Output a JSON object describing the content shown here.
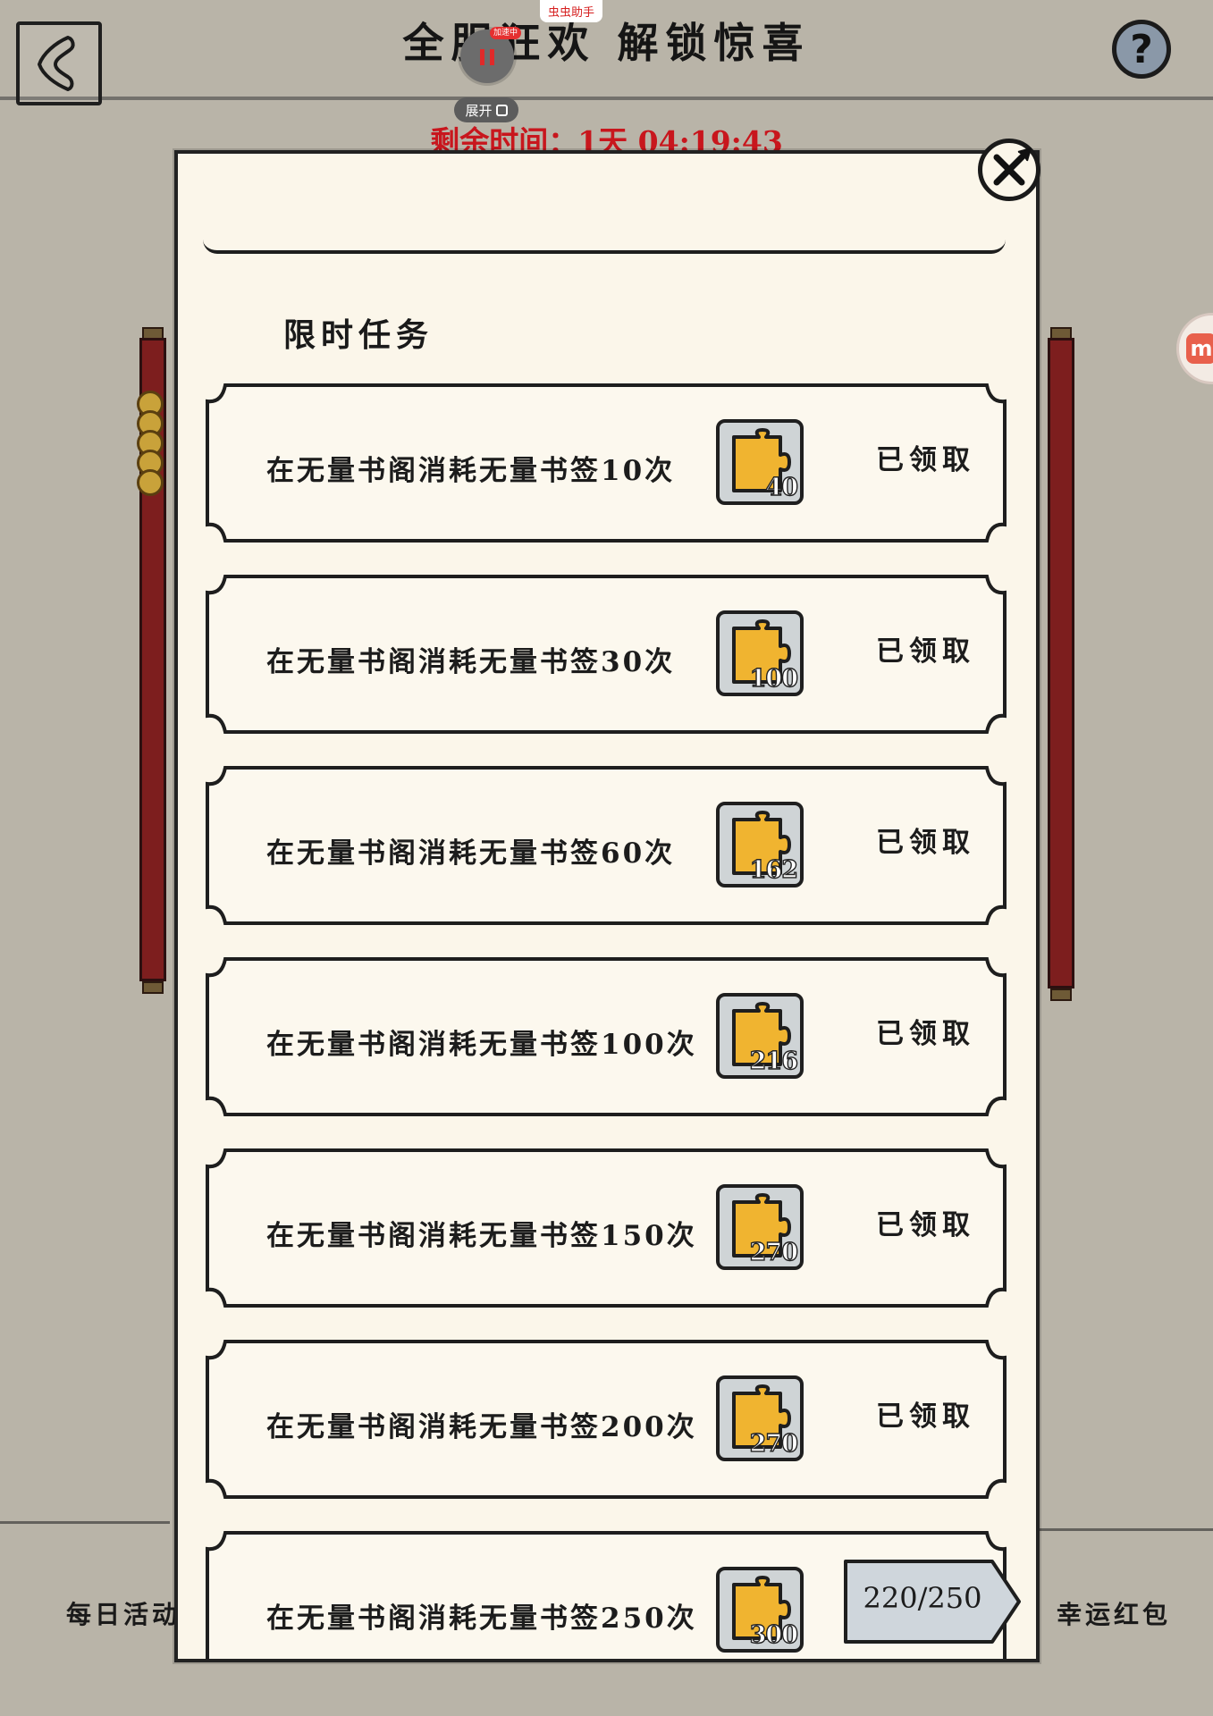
{
  "header": {
    "title": "全服狂欢 解锁惊喜",
    "countdown": "剩余时间：1天 04:19:43"
  },
  "overlay_helper": {
    "tag": "虫虫助手",
    "speed_badge": "加速中",
    "expand_label": "展开"
  },
  "help": {
    "symbol": "?"
  },
  "side_badge": {
    "letter": "m"
  },
  "modal": {
    "section_title": "限时任务",
    "tasks": [
      {
        "description": "在无量书阁消耗无量书签10次",
        "reward_icon": "bookmark-piece-icon",
        "reward_count": "40",
        "status": "已领取"
      },
      {
        "description": "在无量书阁消耗无量书签30次",
        "reward_icon": "bookmark-piece-icon",
        "reward_count": "100",
        "status": "已领取"
      },
      {
        "description": "在无量书阁消耗无量书签60次",
        "reward_icon": "bookmark-piece-icon",
        "reward_count": "162",
        "status": "已领取"
      },
      {
        "description": "在无量书阁消耗无量书签100次",
        "reward_icon": "bookmark-piece-icon",
        "reward_count": "216",
        "status": "已领取"
      },
      {
        "description": "在无量书阁消耗无量书签150次",
        "reward_icon": "bookmark-piece-icon",
        "reward_count": "270",
        "status": "已领取"
      },
      {
        "description": "在无量书阁消耗无量书签200次",
        "reward_icon": "bookmark-piece-icon",
        "reward_count": "270",
        "status": "已领取"
      },
      {
        "description": "在无量书阁消耗无量书签250次",
        "reward_icon": "bookmark-piece-icon",
        "reward_count": "300",
        "progress": "220/250"
      }
    ]
  },
  "bottom_nav": {
    "daily_label": "每日活动",
    "lucky_label": "幸运红包"
  },
  "colors": {
    "countdown": "#c8161d",
    "reward_fill": "#f0b430",
    "modal_bg": "#fbf6ea",
    "backdrop": "#b9b4a8"
  }
}
